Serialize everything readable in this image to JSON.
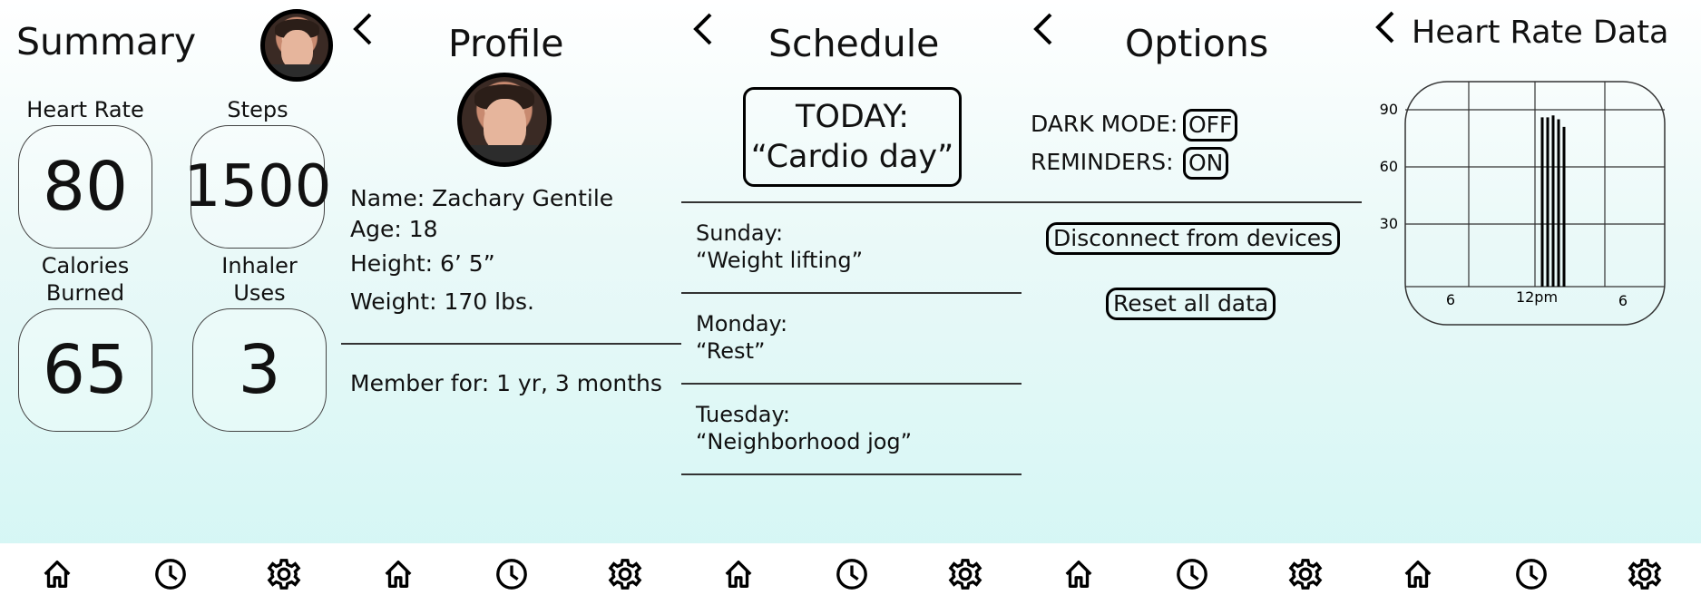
{
  "summary": {
    "title": "Summary",
    "stats": [
      {
        "label": "Heart Rate",
        "value": "80"
      },
      {
        "label": "Steps",
        "value": "1500"
      },
      {
        "label": "Calories Burned",
        "value": "65"
      },
      {
        "label": "Inhaler Uses",
        "value": "3"
      }
    ]
  },
  "profile": {
    "title": "Profile",
    "name": "Name: Zachary Gentile",
    "age": "Age: 18",
    "height": "Height: 6’ 5”",
    "weight": "Weight: 170 lbs.",
    "member": "Member for: 1 yr, 3 months"
  },
  "schedule": {
    "title": "Schedule",
    "today_label": "TODAY:",
    "today_value": "“Cardio day”",
    "days": [
      {
        "day": "Sunday:",
        "activity": "“Weight lifting”"
      },
      {
        "day": "Monday:",
        "activity": "“Rest”"
      },
      {
        "day": "Tuesday:",
        "activity": "“Neighborhood jog”"
      }
    ]
  },
  "options": {
    "title": "Options",
    "dark_mode_label": "DARK MODE:",
    "dark_mode_value": "OFF",
    "reminders_label": "REMINDERS:",
    "reminders_value": "ON",
    "disconnect_label": "Disconnect from devices",
    "reset_label": "Reset all data"
  },
  "heart_rate": {
    "title": "Heart Rate Data"
  },
  "chart_data": {
    "type": "bar",
    "title": "Heart Rate Data",
    "x_ticks": [
      "6",
      "12pm",
      "6"
    ],
    "y_ticks": [
      30,
      60,
      90
    ],
    "ylim": [
      0,
      100
    ],
    "grid": true,
    "values": [
      86,
      86,
      87,
      85,
      81
    ]
  },
  "nav_icons": [
    "home-icon",
    "clock-icon",
    "gear-icon"
  ]
}
